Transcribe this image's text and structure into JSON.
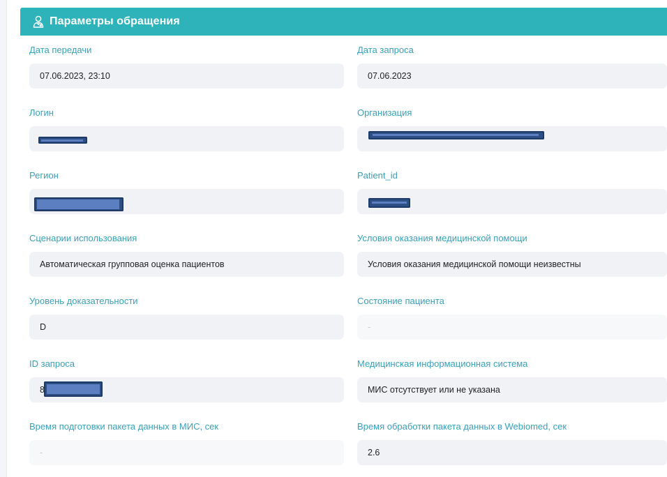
{
  "panel": {
    "title": "Параметры обращения",
    "icon": "doctor-icon",
    "header_color": "#2fb3bb"
  },
  "fields": {
    "transfer_date": {
      "label": "Дата передачи",
      "value": "07.06.2023, 23:10"
    },
    "request_date": {
      "label": "Дата запроса",
      "value": "07.06.2023"
    },
    "login": {
      "label": "Логин",
      "value": ""
    },
    "organization": {
      "label": "Организация",
      "value": ""
    },
    "region": {
      "label": "Регион",
      "value": ""
    },
    "patient_id": {
      "label": "Patient_id",
      "value": ""
    },
    "usage_scenarios": {
      "label": "Сценарии использования",
      "value": "Автоматическая групповая оценка пациентов"
    },
    "care_conditions": {
      "label": "Условия оказания медицинской помощи",
      "value": "Условия оказания медицинской помощи неизвестны"
    },
    "evidence_level": {
      "label": "Уровень доказательности",
      "value": "D"
    },
    "patient_state": {
      "label": "Состояние пациента",
      "value": "-"
    },
    "request_id": {
      "label": "ID запроса",
      "value": "8"
    },
    "mis": {
      "label": "Медицинская информационная система",
      "value": "МИС отсутствует или не указана"
    },
    "mis_prep_time": {
      "label": "Время подготовки пакета данных в МИС, сек",
      "value": "-"
    },
    "webiomed_proc_time": {
      "label": "Время обработки пакета данных в Webiomed, сек",
      "value": "2.6"
    }
  },
  "colors": {
    "label": "#3a9fb8",
    "field_bg": "#f0f2f6",
    "redaction": "#2e4f86"
  }
}
